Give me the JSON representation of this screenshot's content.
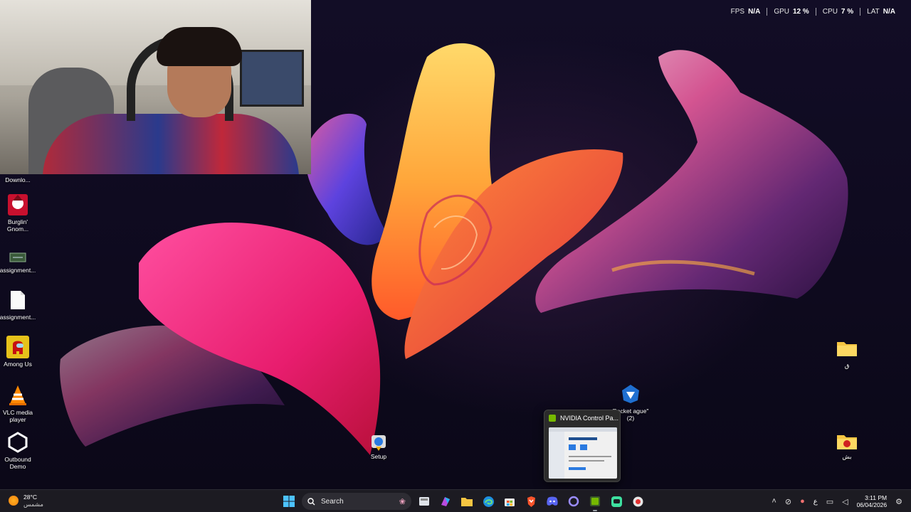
{
  "perf_overlay": [
    {
      "key": "FPS",
      "value": "N/A"
    },
    {
      "key": "GPU",
      "value": "12 %"
    },
    {
      "key": "CPU",
      "value": "7 %"
    },
    {
      "key": "LAT",
      "value": "N/A"
    }
  ],
  "desktop_icons": {
    "downloads": "Downlo...",
    "burglin": "Burglin' Gnom...",
    "assignment1": "assignment...",
    "assignment2": "assignment...",
    "among_us": "Among Us",
    "vlc": "VLC media player",
    "outbound": "Outbound Demo",
    "setup": "Setup",
    "rocket_league": "Rocket ague\" (2)",
    "folder_q": "ق",
    "folder_bsh": "بش"
  },
  "taskbar_preview": {
    "title": "NVIDIA Control Pa..."
  },
  "taskbar": {
    "weather_temp": "28°C",
    "weather_desc": "مشمس",
    "search_label": "Search",
    "language": "ع",
    "time": "3:11 PM",
    "date": "06/04/2026"
  },
  "colors": {
    "taskbar_bg": "#1c1b22",
    "accent_nvidia": "#76b900"
  }
}
